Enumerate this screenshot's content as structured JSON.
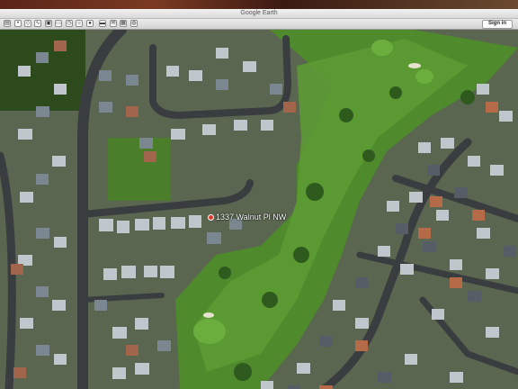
{
  "window": {
    "title": "Google Earth"
  },
  "toolbar": {
    "sign_in_label": "Sign in",
    "tools": [
      "sidebar-icon",
      "placemark-icon",
      "polygon-icon",
      "path-icon",
      "overlay-icon",
      "tour-icon",
      "history-icon",
      "sun-icon",
      "planets-icon",
      "ruler-icon",
      "email-icon",
      "print-icon",
      "maps-icon"
    ]
  },
  "map": {
    "placemark": {
      "label": "1337 Walnut Pl NW"
    },
    "colors": {
      "grass": "#4f8a2c",
      "fairway": "#5c9a34",
      "road": "#3a3d40",
      "roof_light": "#bfc6cc",
      "roof_dark": "#565d66",
      "trees": "#2d4a1c"
    }
  }
}
